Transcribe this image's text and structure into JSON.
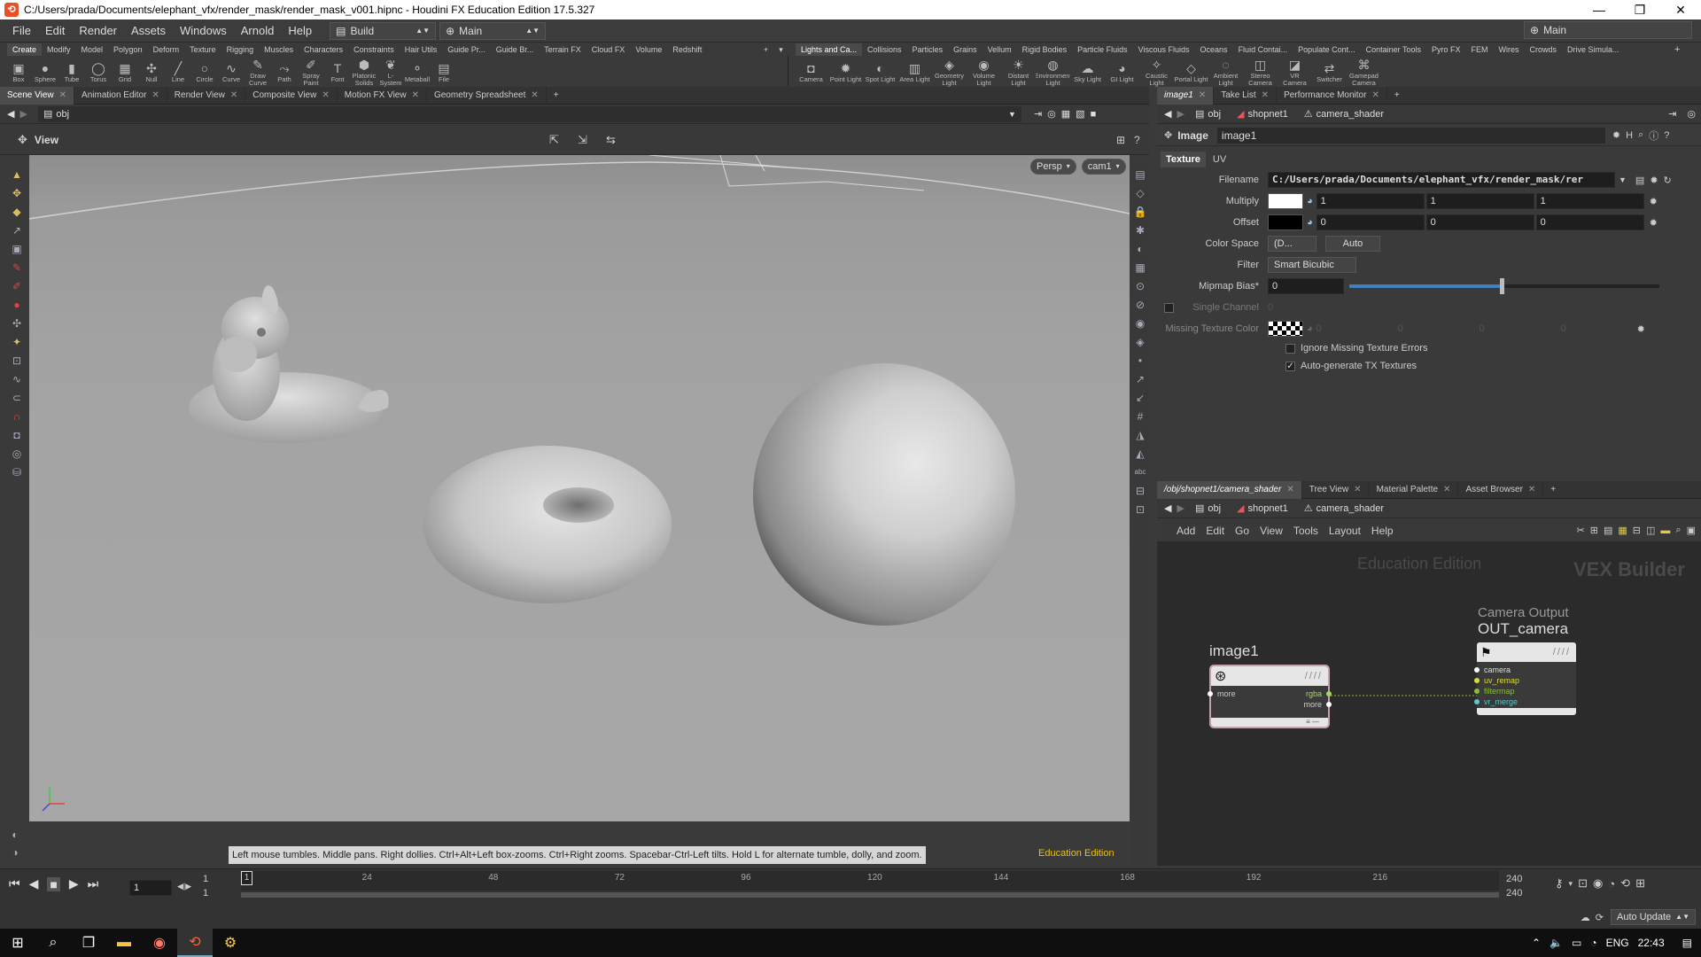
{
  "window": {
    "title": "C:/Users/prada/Documents/elephant_vfx/render_mask/render_mask_v001.hipnc - Houdini FX Education Edition 17.5.327",
    "controls": [
      "—",
      "❐",
      "✕"
    ]
  },
  "menu": {
    "items": [
      "File",
      "Edit",
      "Render",
      "Assets",
      "Windows",
      "Arnold",
      "Help"
    ],
    "desktop": "Build",
    "network": "Main",
    "right_desktop": "Main"
  },
  "shelf": {
    "left_tabs": [
      "Create",
      "Modify",
      "Model",
      "Polygon",
      "Deform",
      "Texture",
      "Rigging",
      "Muscles",
      "Characters",
      "Constraints",
      "Hair Utils",
      "Guide Pr...",
      "Guide Br...",
      "Terrain FX",
      "Cloud FX",
      "Volume",
      "Redshift"
    ],
    "left_tools": [
      {
        "label": "Box",
        "glyph": "▣"
      },
      {
        "label": "Sphere",
        "glyph": "●"
      },
      {
        "label": "Tube",
        "glyph": "▮"
      },
      {
        "label": "Torus",
        "glyph": "◯"
      },
      {
        "label": "Grid",
        "glyph": "▦"
      },
      {
        "label": "Null",
        "glyph": "✣"
      },
      {
        "label": "Line",
        "glyph": "╱"
      },
      {
        "label": "Circle",
        "glyph": "○"
      },
      {
        "label": "Curve",
        "glyph": "∿"
      },
      {
        "label": "Draw Curve",
        "glyph": "✎"
      },
      {
        "label": "Path",
        "glyph": "⤳"
      },
      {
        "label": "Spray Paint",
        "glyph": "✐"
      },
      {
        "label": "Font",
        "glyph": "T"
      },
      {
        "label": "Platonic Solids",
        "glyph": "⬢"
      },
      {
        "label": "L-System",
        "glyph": "❦"
      },
      {
        "label": "Metaball",
        "glyph": "⚬"
      },
      {
        "label": "File",
        "glyph": "▤"
      }
    ],
    "right_tabs": [
      "Lights and Ca...",
      "Collisions",
      "Particles",
      "Grains",
      "Vellum",
      "Rigid Bodies",
      "Particle Fluids",
      "Viscous Fluids",
      "Oceans",
      "Fluid Contai...",
      "Populate Cont...",
      "Container Tools",
      "Pyro FX",
      "FEM",
      "Wires",
      "Crowds",
      "Drive Simula..."
    ],
    "right_tools": [
      {
        "label": "Camera",
        "glyph": "◘"
      },
      {
        "label": "Point Light",
        "glyph": "✹"
      },
      {
        "label": "Spot Light",
        "glyph": "◐"
      },
      {
        "label": "Area Light",
        "glyph": "▥"
      },
      {
        "label": "Geometry Light",
        "glyph": "◈"
      },
      {
        "label": "Volume Light",
        "glyph": "◉"
      },
      {
        "label": "Distant Light",
        "glyph": "☀"
      },
      {
        "label": "Environment Light",
        "glyph": "◍"
      },
      {
        "label": "Sky Light",
        "glyph": "☁"
      },
      {
        "label": "GI Light",
        "glyph": "◕"
      },
      {
        "label": "Caustic Light",
        "glyph": "✧"
      },
      {
        "label": "Portal Light",
        "glyph": "◇"
      },
      {
        "label": "Ambient Light",
        "glyph": "◌"
      },
      {
        "label": "Stereo Camera",
        "glyph": "◫"
      },
      {
        "label": "VR Camera",
        "glyph": "◪"
      },
      {
        "label": "Switcher",
        "glyph": "⇄"
      },
      {
        "label": "Gamepad Camera",
        "glyph": "⌘"
      }
    ]
  },
  "left_pane": {
    "tabs": [
      "Scene View",
      "Animation Editor",
      "Render View",
      "Composite View",
      "Motion FX View",
      "Geometry Spreadsheet"
    ],
    "path": "obj",
    "view_label": "View",
    "persp": "Persp",
    "cam": "cam1",
    "hint": "Left mouse tumbles. Middle pans. Right dollies. Ctrl+Alt+Left box-zooms. Ctrl+Right zooms. Spacebar-Ctrl-Left tilts. Hold L for alternate tumble, dolly, and zoom.",
    "edu": "Education Edition"
  },
  "param_pane": {
    "tabs": [
      "image1",
      "Take List",
      "Performance Monitor"
    ],
    "path": [
      "obj",
      "shopnet1",
      "camera_shader"
    ],
    "node_type": "Image",
    "node_name": "image1",
    "subtabs": [
      "Texture",
      "UV"
    ],
    "filename_label": "Filename",
    "filename": "C:/Users/prada/Documents/elephant_vfx/render_mask/rer",
    "multiply_label": "Multiply",
    "multiply": [
      "1",
      "1",
      "1"
    ],
    "offset_label": "Offset",
    "offset": [
      "0",
      "0",
      "0"
    ],
    "colorspace_label": "Color Space",
    "colorspace": "(D...",
    "colorspace2": "Auto",
    "filter_label": "Filter",
    "filter": "Smart Bicubic",
    "mipmap_label": "Mipmap Bias*",
    "mipmap": "0",
    "mipmap_level": 0.49,
    "single_label": "Single Channel",
    "single_value": "0",
    "missing_label": "Missing Texture Color",
    "missing": [
      "0",
      "0",
      "0",
      "0"
    ],
    "ignore_label": "Ignore Missing Texture Errors",
    "autogen_label": "Auto-generate TX Textures"
  },
  "network_pane": {
    "tabs": [
      "/obj/shopnet1/camera_shader",
      "Tree View",
      "Material Palette",
      "Asset Browser"
    ],
    "path": [
      "obj",
      "shopnet1",
      "camera_shader"
    ],
    "menu": [
      "Add",
      "Edit",
      "Go",
      "View",
      "Tools",
      "Layout",
      "Help"
    ],
    "watermark_edu": "Education Edition",
    "watermark_ctx": "VEX Builder",
    "node1": {
      "name": "image1",
      "in": "more",
      "outs": [
        "rgba",
        "more"
      ]
    },
    "node2": {
      "type": "Camera Output",
      "name": "OUT_camera",
      "ins": [
        "camera",
        "uv_remap",
        "filtermap",
        "vr_merge"
      ]
    }
  },
  "timeline": {
    "frame": "1",
    "start": "1",
    "start2": "1",
    "end": "240",
    "end2": "240",
    "ticks": [
      "1",
      "24",
      "48",
      "72",
      "96",
      "120",
      "144",
      "168",
      "192",
      "216"
    ],
    "auto_update": "Auto Update"
  },
  "taskbar": {
    "lang": "ENG",
    "time": "22:43"
  },
  "colors": {
    "accent": "#e3c02a",
    "edu": "#d9b52e",
    "node_border": "#c7a1a8"
  }
}
